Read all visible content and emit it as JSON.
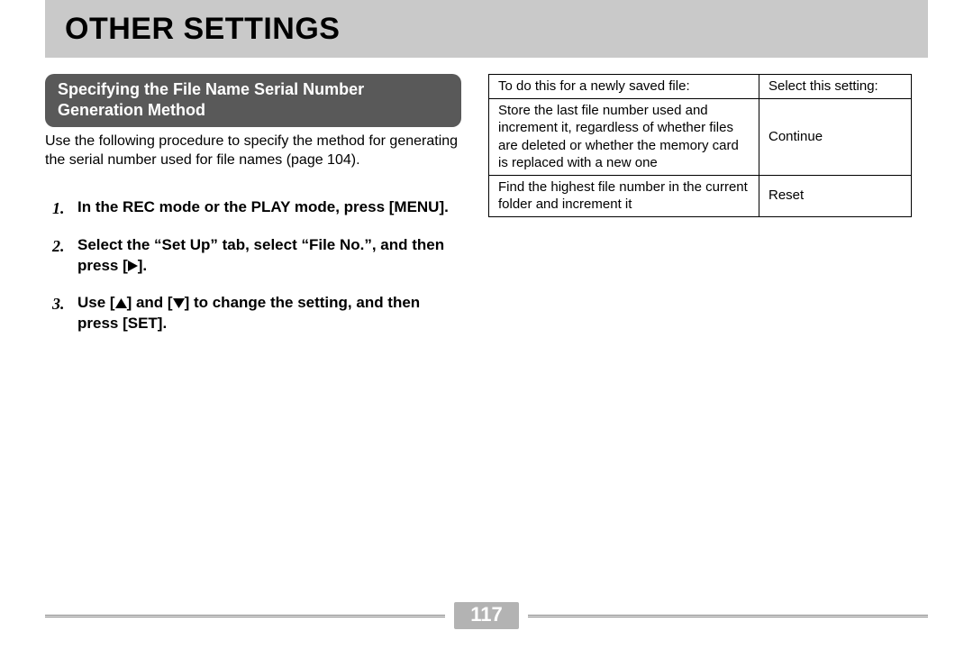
{
  "header": {
    "title": "OTHER SETTINGS"
  },
  "section": {
    "title": "Specifying the File Name Serial Number Generation Method",
    "intro": "Use the following procedure to specify the method for generating the serial number used for file names (page 104)."
  },
  "steps": [
    {
      "pre": "In the REC mode or the PLAY mode, press [MENU]."
    },
    {
      "pre": "Select the “Set Up” tab, select “File No.”, and then press [",
      "glyph": "right",
      "post": "]."
    },
    {
      "pre": "Use [",
      "glyph": "up",
      "mid": "] and [",
      "glyph2": "down",
      "post": "] to change the setting, and then press [SET]."
    }
  ],
  "table": {
    "head": {
      "c1": "To do this for a newly saved file:",
      "c2": "Select this setting:"
    },
    "rows": [
      {
        "c1": "Store the last file number used and increment it, regardless of whether files are deleted or whether the memory card is replaced with a new one",
        "c2": "Continue"
      },
      {
        "c1": "Find the highest file number in the current folder and increment it",
        "c2": "Reset"
      }
    ]
  },
  "page_number": "117"
}
